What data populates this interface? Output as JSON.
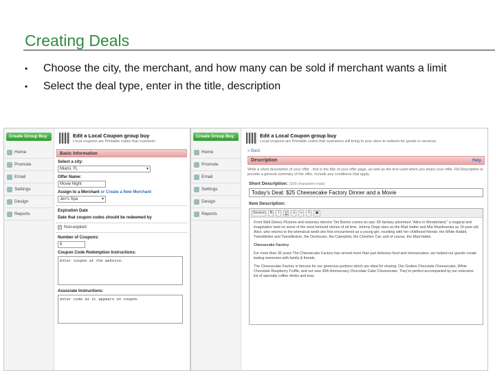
{
  "slide": {
    "title": "Creating Deals",
    "bullets": [
      {
        "marker": "•",
        "text": "Choose the city, the merchant, and how many can be sold if merchant wants a limit"
      },
      {
        "marker": "•",
        "text": "Select the deal type, enter in the title, description"
      }
    ]
  },
  "sidebar": {
    "create_button": "Create Group Buy",
    "items": [
      "Home",
      "Promote",
      "Email",
      "Settings",
      "Design",
      "Reports"
    ]
  },
  "panel_a": {
    "header_title": "Edit a Local Coupon group buy",
    "header_subtitle": "Local coupons are Printable codes that customers will bring to your store to redeem for goods or services.",
    "section_title": "Basic Information",
    "city_label": "Select a city:",
    "city_value": "Miami, FL",
    "offer_name_label": "Offer Name:",
    "offer_name_value": "Movie Night",
    "merchant_label": "Assign to a Merchant",
    "merchant_link": "or Create a New Merchant",
    "merchant_value": "Jen's Spa",
    "expiration_label": "Expiration Date",
    "expiration_desc": "Date that coupon codes should be redeemed by",
    "non_expired_label": "Non-expired",
    "num_coupons_label": "Number of Coupons:",
    "num_coupons_value": "6",
    "redemption_label": "Coupon Code Redemption Instructions:",
    "redemption_value": "Enter coupon at the website.",
    "associate_label": "Associate Instructions:",
    "associate_value": "enter code as it appears on coupon."
  },
  "panel_b": {
    "header_title": "Edit a Local Coupon group buy",
    "header_subtitle": "Local coupons are Printable codes that customers will bring to your store to redeem for goods or services.",
    "back_link": "« Back",
    "section_title": "Description",
    "help_link": "Help",
    "instructions": "Write a short description of your offer - this is the title of your offer page, as well as the text used when you share your offer. Fill Description to provide a general summary of the offer. Include any conditions that apply.",
    "short_desc_label": "Short Description:",
    "short_desc_hint": "(100 characters max)",
    "short_desc_value": "Today's Deal: $25 Cheesecake Factory Dinner and a Movie",
    "item_desc_label": "Item Description:",
    "toolbar_source": "Source",
    "editor_paragraphs": [
      "From Walt Disney Pictures and visionary director Tim Burton comes an epic 3D fantasy adventure \"Alice in Wonderland,\" a magical and imaginative twist on some of the most beloved stories of all time. Johnny Depp stars as the Mad Hatter and Mia Wasikowska as 19-year-old Alice, who returns to the whimsical world she first encountered as a young girl, reuniting with her childhood friends: the White Rabbit, Tweedledee and Tweedledum, the Dormouse, the Caterpillar, the Cheshire Cat, and of course, the Mad Hatter.",
      "Cheesecake Factory",
      "For more than 30 years The Cheesecake Factory has served more than just delicious food and cheesecakes, we helped our guests create lasting memories with family & friends.",
      "The Cheesecake Factory is famous for our generous portions which are ideal for sharing. Our Godiva Chocolate Cheesecake, White Chocolate Raspberry Truffle, and our new 30th Anniversary Chocolate Cake Cheesecake. They're perfect accompanied by our extensive list of specialty coffee drinks and teas."
    ]
  }
}
